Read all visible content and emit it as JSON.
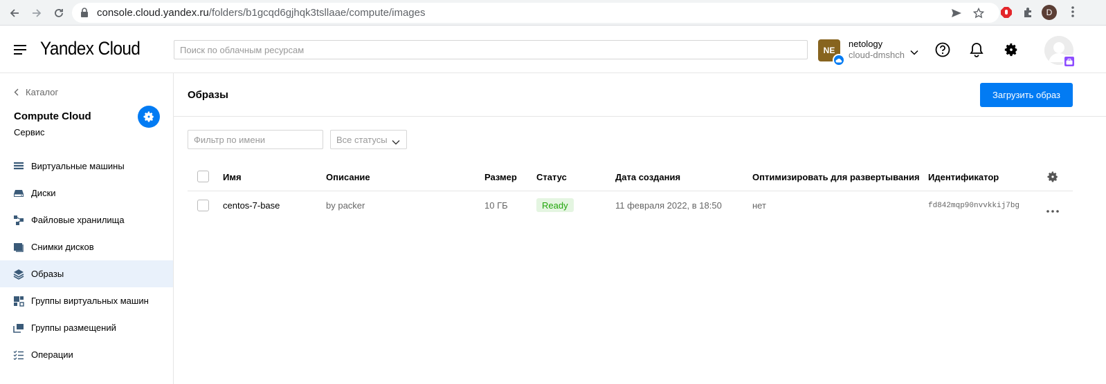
{
  "browser": {
    "url_host": "console.cloud.yandex.ru",
    "url_path": "/folders/b1gcqd6gjhqk3tsllaae/compute/images",
    "profile_initial": "D",
    "icons": [
      "back-arrow-icon",
      "forward-arrow-icon",
      "reload-icon",
      "lock-icon",
      "send-icon",
      "star-icon",
      "adblock-icon",
      "extensions-icon",
      "menu-kebab-icon"
    ]
  },
  "header": {
    "logo": "Yandex Cloud",
    "search_placeholder": "Поиск по облачным ресурсам",
    "org_initials": "NE",
    "org_name": "netology",
    "cloud_name": "cloud-dmshch"
  },
  "sidebar": {
    "back_label": "Каталог",
    "service_title": "Compute Cloud",
    "service_subtitle": "Сервис",
    "items": [
      {
        "label": "Виртуальные машины",
        "icon": "vm-icon"
      },
      {
        "label": "Диски",
        "icon": "disk-icon"
      },
      {
        "label": "Файловые хранилища",
        "icon": "filestore-icon"
      },
      {
        "label": "Снимки дисков",
        "icon": "snapshot-icon"
      },
      {
        "label": "Образы",
        "icon": "layers-icon",
        "active": true
      },
      {
        "label": "Группы виртуальных машин",
        "icon": "vm-group-icon"
      },
      {
        "label": "Группы размещений",
        "icon": "placement-icon"
      },
      {
        "label": "Операции",
        "icon": "operations-icon"
      }
    ]
  },
  "main": {
    "title": "Образы",
    "upload_label": "Загрузить образ",
    "filter_placeholder": "Фильтр по имени",
    "status_select": "Все статусы",
    "columns": [
      "Имя",
      "Описание",
      "Размер",
      "Статус",
      "Дата создания",
      "Оптимизировать для развертывания",
      "Идентификатор"
    ],
    "rows": [
      {
        "name": "centos-7-base",
        "description": "by packer",
        "size": "10 ГБ",
        "status": "Ready",
        "created": "11 февраля 2022, в 18:50",
        "optimize": "нет",
        "id": "fd842mqp90nvvkkij7bg"
      }
    ]
  },
  "colors": {
    "accent": "#027bf3",
    "ready_text": "#20a50a",
    "ready_bg": "#e4f5e1",
    "active_nav": "#e9f1fb"
  }
}
